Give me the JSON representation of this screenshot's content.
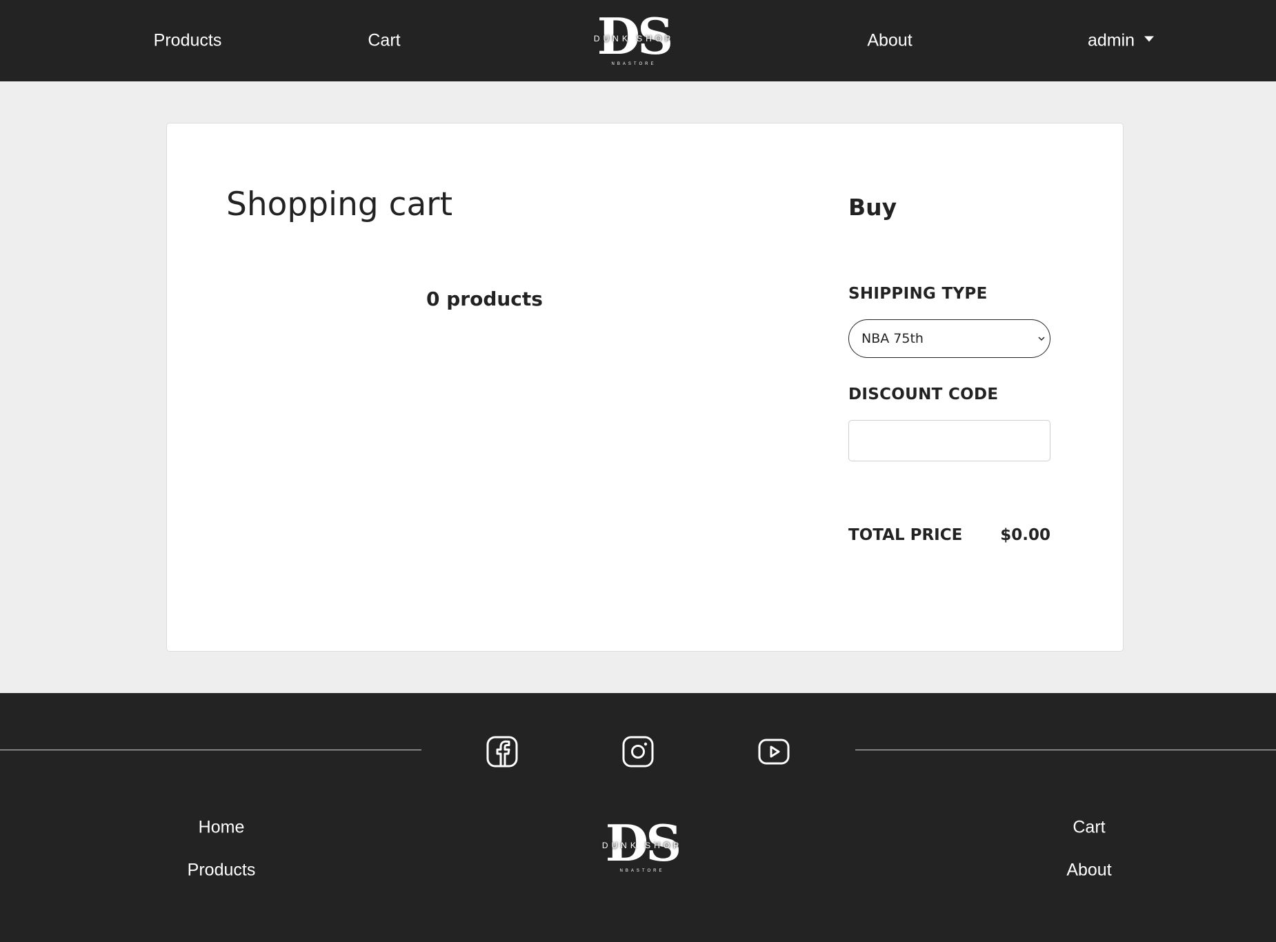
{
  "header": {
    "nav": {
      "products": "Products",
      "cart": "Cart",
      "about": "About",
      "admin": "admin"
    },
    "logo": {
      "mark": "DS",
      "name": "DUNK SHOP",
      "tagline": "NBASTORE"
    }
  },
  "cart": {
    "title": "Shopping cart",
    "products_count": "0 products"
  },
  "buy": {
    "title": "Buy",
    "shipping_label": "SHIPPING TYPE",
    "shipping_selected": "NBA 75th",
    "discount_label": "DISCOUNT CODE",
    "discount_value": "",
    "total_label": "TOTAL PRICE",
    "total_value": "$0.00"
  },
  "footer": {
    "links_left": [
      "Home",
      "Products"
    ],
    "links_right": [
      "Cart",
      "About"
    ],
    "social": [
      "facebook-icon",
      "instagram-icon",
      "youtube-icon"
    ],
    "logo": {
      "mark": "DS",
      "name": "DUNK SHOP",
      "tagline": "NBASTORE"
    }
  },
  "colors": {
    "dark": "#242323",
    "background": "#eeeeee",
    "card": "#ffffff",
    "text": "#222222"
  }
}
